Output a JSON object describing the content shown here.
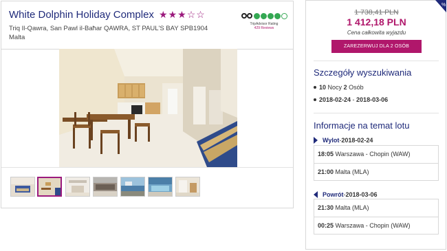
{
  "hotel": {
    "name": "White Dolphin Holiday Complex",
    "stars_filled": 3,
    "stars_total": 5,
    "address_line1": "Triq Il-Qawra, San Pawl il-Baħar QAWRA, ST PAUL'S BAY SPB1904",
    "address_line2": "Malta"
  },
  "tripadvisor": {
    "rating": 4,
    "label": "TripAdvisor Rating",
    "reviews": "429 Reviews",
    "color": "#34a853"
  },
  "gallery": {
    "selected_index": 1,
    "thumb_count": 7
  },
  "price": {
    "old": "1 738,41 PLN",
    "new": "1 412,18 PLN",
    "note": "Cena całkowita wyjazdu",
    "book_label": "ZAREZERWUJ DLA 2 OSÓB",
    "accent": "#b0176b"
  },
  "search": {
    "title": "Szczegóły wyszukiwania",
    "nights_num": "10",
    "nights_label": "Nocy",
    "people_num": "2",
    "people_label": "Osób",
    "date_from": "2018-02-24",
    "date_sep": " - ",
    "date_to": "2018-03-06"
  },
  "flight": {
    "title": "Informacje na temat lotu",
    "outbound": {
      "label": "Wylot",
      "sep": " - ",
      "date": "2018-02-24",
      "rows": [
        {
          "time": "18:05",
          "place": "Warszawa - Chopin (WAW)"
        },
        {
          "time": "21:00",
          "place": "Malta (MLA)"
        }
      ]
    },
    "inbound": {
      "label": "Powrót",
      "sep": " - ",
      "date": "2018-03-06",
      "rows": [
        {
          "time": "21:30",
          "place": "Malta (MLA)"
        },
        {
          "time": "00:25",
          "place": "Warszawa - Chopin (WAW)"
        }
      ]
    }
  },
  "colors": {
    "brand_navy": "#1f2a7a",
    "brand_magenta": "#9b1a7d"
  }
}
